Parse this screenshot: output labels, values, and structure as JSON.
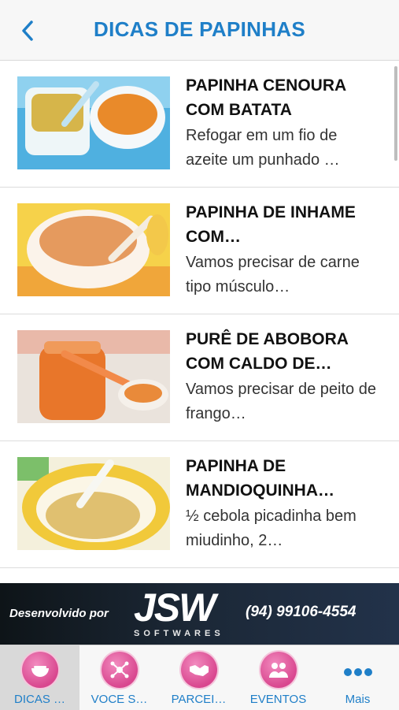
{
  "header": {
    "back_icon": "chevron-left-icon",
    "title": "DICAS DE PAPINHAS"
  },
  "recipes": [
    {
      "title": "PAPINHA CENOURA COM BATATA",
      "description": "Refogar em um fio de azeite um punhado …"
    },
    {
      "title": "PAPINHA DE INHAME COM…",
      "description": "Vamos precisar de carne tipo músculo…"
    },
    {
      "title": "PURÊ DE ABOBORA COM CALDO DE…",
      "description": "Vamos precisar de peito de frango…"
    },
    {
      "title": "PAPINHA DE MANDIOQUINHA…",
      "description": "½ cebola picadinha bem miudinho, 2…"
    }
  ],
  "banner": {
    "developed_by": "Desenvolvido por",
    "logo": "JSW",
    "logo_sub": "SOFTWARES",
    "phone": "(94) 99106-4554"
  },
  "tabs": [
    {
      "label": "DICAS …",
      "icon": "bowl-icon",
      "active": true
    },
    {
      "label": "VOCE S…",
      "icon": "molecule-icon",
      "active": false
    },
    {
      "label": "PARCEI…",
      "icon": "handshake-icon",
      "active": false
    },
    {
      "label": "EVENTOS",
      "icon": "people-icon",
      "active": false
    },
    {
      "label": "Mais",
      "icon": "more-dots-icon",
      "active": false
    }
  ],
  "colors": {
    "accent": "#1f7fc8",
    "tab_icon": "#d9478f"
  }
}
